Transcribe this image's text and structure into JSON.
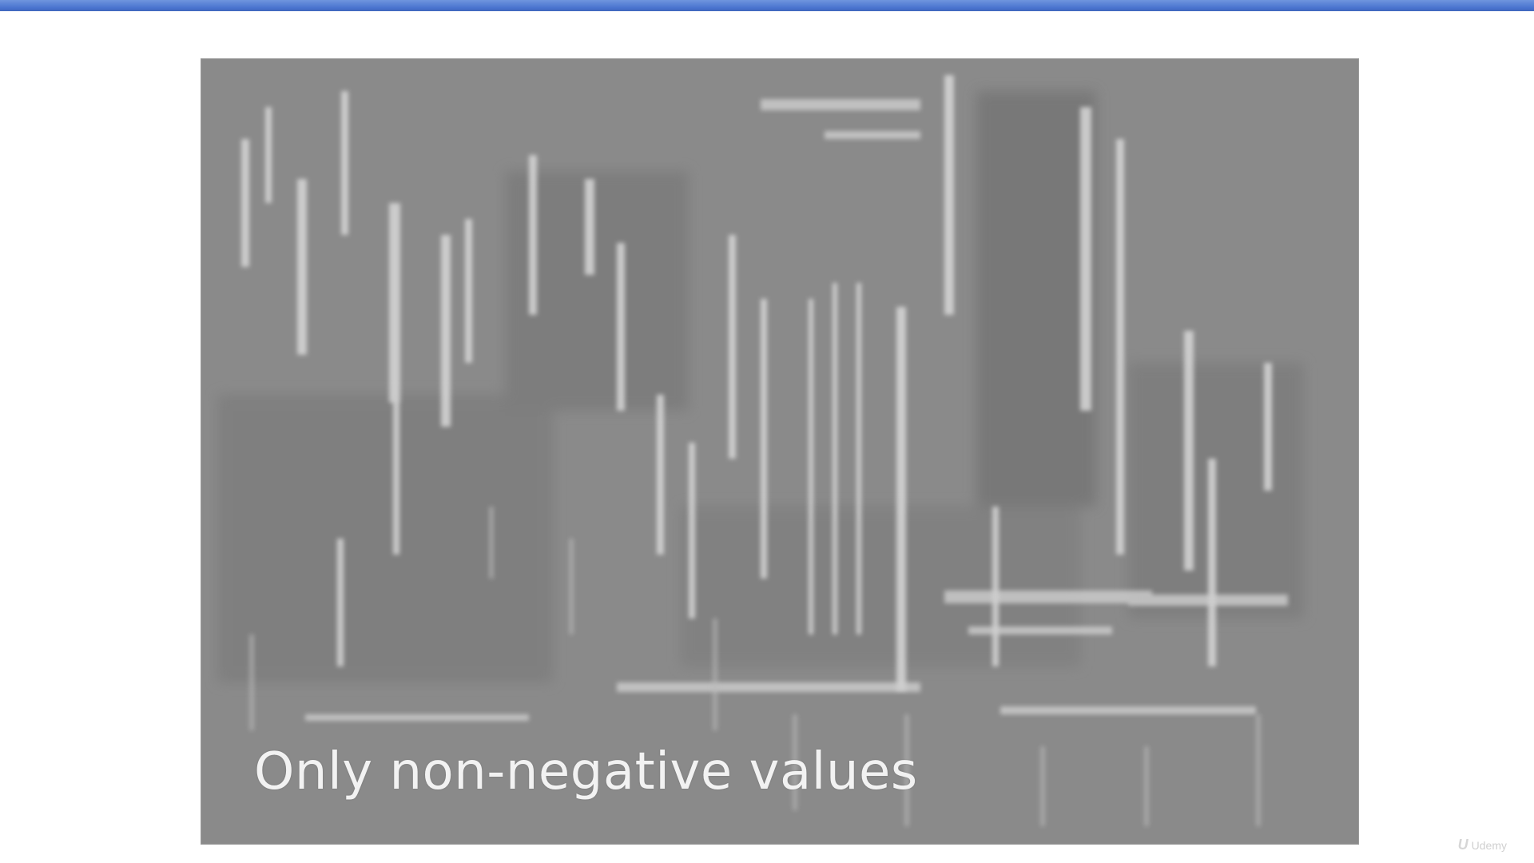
{
  "slide": {
    "caption": "Only non-negative values",
    "image_description_icon": "feature-map-image"
  },
  "watermark": {
    "brand": "Udemy"
  },
  "colors": {
    "top_bar": "#4a74cf",
    "image_background": "#8a8a8a",
    "caption_text": "#f2f2f2"
  }
}
